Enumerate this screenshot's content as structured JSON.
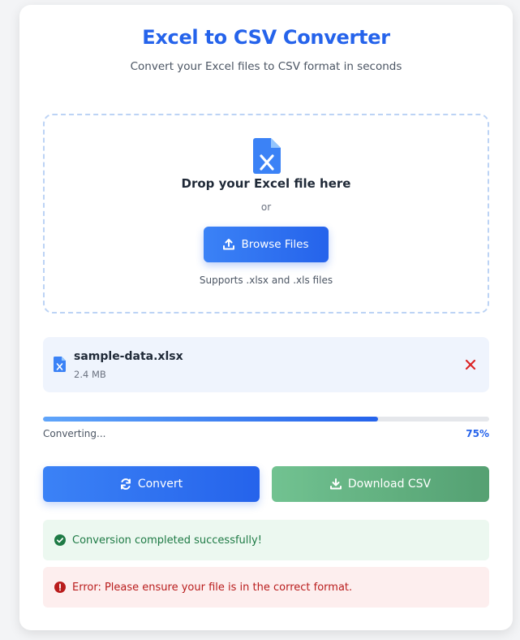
{
  "header": {
    "title": "Excel to CSV Converter",
    "subtitle": "Convert your Excel files to CSV format in seconds"
  },
  "dropzone": {
    "icon": "excel-file-icon",
    "title": "Drop your Excel file here",
    "or_text": "or",
    "browse_label": "Browse Files",
    "browse_icon": "upload-icon",
    "support_text": "Supports .xlsx and .xls files"
  },
  "file": {
    "name": "sample-data.xlsx",
    "size": "2.4 MB",
    "icon": "excel-file-icon",
    "remove_icon": "close-icon"
  },
  "progress": {
    "label": "Converting...",
    "percent_text": "75%",
    "value": 0.75
  },
  "actions": {
    "convert_label": "Convert",
    "convert_icon": "sync-icon",
    "download_label": "Download CSV",
    "download_icon": "download-icon"
  },
  "alerts": {
    "success": "Conversion completed successfully!",
    "error": "Error: Please ensure your file is in the correct format."
  },
  "colors": {
    "primary": "#2563eb",
    "success": "#1e7a45",
    "error": "#b91c1c",
    "download": "#5bab7b"
  }
}
